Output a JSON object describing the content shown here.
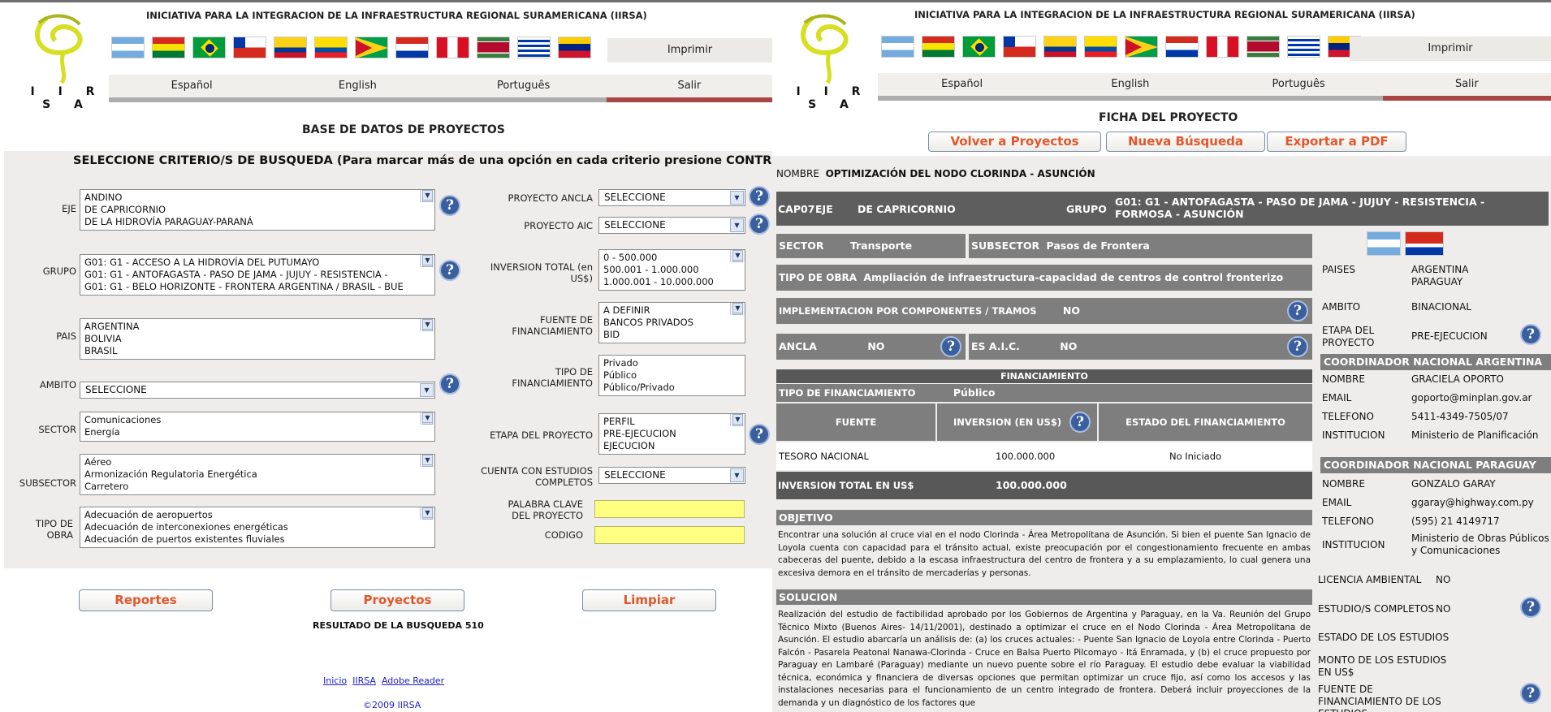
{
  "header": {
    "initiative": "INICIATIVA PARA LA INTEGRACION DE LA INFRAESTRUCTURA REGIONAL SURAMERICANA (IIRSA)",
    "logo_text": "I I R S A",
    "print_label": "Imprimir",
    "languages": [
      "Español",
      "English",
      "Português",
      "Salir"
    ]
  },
  "left": {
    "page_title": "BASE DE DATOS DE PROYECTOS",
    "subtitle": "SELECCIONE CRITERIO/S DE BUSQUEDA (Para marcar más de una opción en cada criterio presione CONTROL+Click)",
    "fields": {
      "eje": {
        "label": "EJE",
        "options": [
          "ANDINO",
          "DE CAPRICORNIO",
          "DE LA HIDROVÍA PARAGUAY-PARANÁ"
        ]
      },
      "grupo": {
        "label": "GRUPO",
        "options": [
          "G01: G1 - ACCESO A LA HIDROVÍA DEL PUTUMAYO",
          "G01: G1 - ANTOFAGASTA - PASO DE JAMA - JUJUY - RESISTENCIA -",
          "G01: G1 - BELO HORIZONTE - FRONTERA ARGENTINA / BRASIL - BUE"
        ]
      },
      "pais": {
        "label": "PAIS",
        "options": [
          "ARGENTINA",
          "BOLIVIA",
          "BRASIL"
        ]
      },
      "ambito": {
        "label": "AMBITO",
        "value": "SELECCIONE"
      },
      "sector": {
        "label": "SECTOR",
        "options": [
          "Comunicaciones",
          "Energía"
        ]
      },
      "subsector": {
        "label": "SUBSECTOR",
        "options": [
          "Aéreo",
          "Armonización Regulatoria Energética",
          "Carretero"
        ]
      },
      "tipo_obra": {
        "label": "TIPO DE OBRA",
        "options": [
          "Adecuación de aeropuertos",
          "Adecuación de interconexiones energéticas",
          "Adecuación de puertos existentes fluviales"
        ]
      },
      "proyecto_ancla": {
        "label": "PROYECTO ANCLA",
        "value": "SELECCIONE"
      },
      "proyecto_aic": {
        "label": "PROYECTO AIC",
        "value": "SELECCIONE"
      },
      "inversion_total": {
        "label": "INVERSION TOTAL (en US$)",
        "options": [
          "0 - 500.000",
          "500.001 - 1.000.000",
          "1.000.001 - 10.000.000"
        ]
      },
      "fuente_financiamiento": {
        "label": "FUENTE DE FINANCIAMIENTO",
        "options": [
          "A DEFINIR",
          "BANCOS PRIVADOS",
          "BID"
        ]
      },
      "tipo_financiamiento": {
        "label": "TIPO DE FINANCIAMIENTO",
        "options": [
          "Privado",
          "Público",
          "Público/Privado"
        ]
      },
      "etapa_proyecto": {
        "label": "ETAPA DEL PROYECTO",
        "options": [
          "PERFIL",
          "PRE-EJECUCION",
          "EJECUCION"
        ]
      },
      "estudios_completos": {
        "label": "CUENTA CON ESTUDIOS COMPLETOS",
        "value": "SELECCIONE"
      },
      "palabra_clave": {
        "label": "PALABRA CLAVE DEL PROYECTO",
        "value": ""
      },
      "codigo": {
        "label": "CODIGO",
        "value": ""
      }
    },
    "buttons": {
      "reportes": "Reportes",
      "proyectos": "Proyectos",
      "limpiar": "Limpiar"
    },
    "result_text": "RESULTADO DE LA BUSQUEDA 510",
    "footer_links": [
      "Inicio",
      "IIRSA",
      "Adobe Reader"
    ],
    "copyright": "©2009 IIRSA"
  },
  "right": {
    "page_title": "FICHA DEL PROYECTO",
    "buttons": {
      "volver": "Volver a Proyectos",
      "nueva": "Nueva Búsqueda",
      "exportar": "Exportar a PDF"
    },
    "nombre_label": "NOMBRE",
    "nombre_value": "OPTIMIZACIÓN DEL NODO CLORINDA - ASUNCIÓN",
    "code": "CAP07",
    "eje_label": "EJE",
    "eje_value": "DE CAPRICORNIO",
    "grupo_label": "GRUPO",
    "grupo_value": "G01: G1 - ANTOFAGASTA - PASO DE JAMA - JUJUY - RESISTENCIA - FORMOSA - ASUNCIÓN",
    "sector_label": "SECTOR",
    "sector_value": "Transporte",
    "subsector_label": "SUBSECTOR",
    "subsector_value": "Pasos de Frontera",
    "tipo_obra_label": "TIPO DE OBRA",
    "tipo_obra_value": "Ampliación de infraestructura-capacidad de centros de control fronterizo",
    "implementacion_label": "IMPLEMENTACION POR COMPONENTES / TRAMOS",
    "implementacion_value": "NO",
    "ancla_label": "ANCLA",
    "ancla_value": "NO",
    "aic_label": "ES A.I.C.",
    "aic_value": "NO",
    "financiamiento_header": "FINANCIAMIENTO",
    "tipo_fin_label": "TIPO DE FINANCIAMIENTO",
    "tipo_fin_value": "Público",
    "fin_columns": [
      "FUENTE",
      "INVERSION (EN US$)",
      "ESTADO DEL FINANCIAMIENTO"
    ],
    "fin_row": {
      "fuente": "TESORO NACIONAL",
      "inversion": "100.000.000",
      "estado": "No Iniciado"
    },
    "inversion_total_label": "INVERSION TOTAL EN US$",
    "inversion_total_value": "100.000.000",
    "objetivo_label": "OBJETIVO",
    "objetivo_text": "Encontrar una solución al cruce vial en el nodo Clorinda - Área Metropolitana de Asunción. Si bien el puente San Ignacio de Loyola cuenta con capacidad para el tránsito actual, existe preocupación por el congestionamiento frecuente en ambas cabeceras del puente, debido a la escasa infraestructura del centro de frontera y a su emplazamiento, lo cual genera una excesiva demora en el tránsito de mercaderías y personas.",
    "solucion_label": "SOLUCION",
    "solucion_text": "Realización del estudio de factibilidad aprobado por los Gobiernos de Argentina y Paraguay, en la Va. Reunión del Grupo Técnico Mixto (Buenos Aires- 14/11/2001), destinado a optimizar el cruce en el Nodo Clorinda - Área Metropolitana de Asunción. El estudio abarcaría un análisis de: (a) los cruces actuales: - Puente San Ignacio de Loyola entre Clorinda - Puerto Falcón - Pasarela Peatonal Nanawa-Clorinda - Cruce en Balsa Puerto Pilcomayo - Itá Enramada, y (b) el cruce propuesto por Paraguay en Lambaré (Paraguay) mediante un nuevo puente sobre el río Paraguay. El estudio debe evaluar la viabilidad técnica, económica y financiera de diversas opciones que permitan optimizar un cruce fijo, así como los accesos y las instalaciones necesarias para el funcionamiento de un centro integrado de frontera. Deberá incluir proyecciones de la demanda y un diagnóstico de los factores que",
    "side": {
      "paises_label": "PAISES",
      "paises_value": [
        "ARGENTINA",
        "PARAGUAY"
      ],
      "ambito_label": "AMBITO",
      "ambito_value": "BINACIONAL",
      "etapa_label": "ETAPA DEL PROYECTO",
      "etapa_value": "PRE-EJECUCION",
      "coord_ar_header": "COORDINADOR NACIONAL ARGENTINA",
      "coord_ar": {
        "nombre": "GRACIELA OPORTO",
        "email": "goporto@minplan.gov.ar",
        "telefono": "5411-4349-7505/07",
        "institucion": "Ministerio de Planificación"
      },
      "coord_py_header": "COORDINADOR NACIONAL PARAGUAY",
      "coord_py": {
        "nombre": "GONZALO GARAY",
        "email": "ggaray@highway.com.py",
        "telefono": "(595) 21 4149717",
        "institucion": "Ministerio de Obras Públicos y Comunicaciones"
      },
      "labels": {
        "nombre": "NOMBRE",
        "email": "EMAIL",
        "telefono": "TELEFONO",
        "institucion": "INSTITUCION"
      },
      "licencia_label": "LICENCIA AMBIENTAL",
      "licencia_value": "NO",
      "estudios_label": "ESTUDIO/S COMPLETOS",
      "estudios_value": "NO",
      "estado_estudios_label": "ESTADO DE LOS ESTUDIOS",
      "monto_label": "MONTO DE LOS ESTUDIOS EN US$",
      "fuente_label": "FUENTE DE FINANCIAMIENTO DE LOS ESTUDIOS"
    }
  },
  "colors": {
    "accent_button_text": "#e4562a",
    "help_icon": "#3a5f9e",
    "gray_bar": "#7e7e7e",
    "exit_bar": "#a94545",
    "highlight_field": "#ffff80"
  }
}
